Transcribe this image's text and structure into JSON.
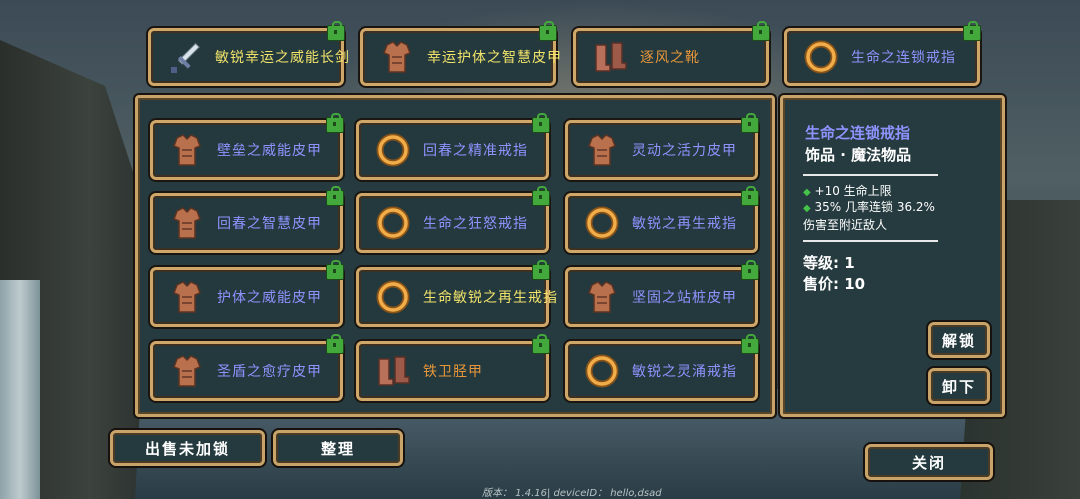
{
  "colors": {
    "name_blue": "#8e93ff",
    "name_yellow": "#f2e36a",
    "name_orange": "#e7963a",
    "lock_green": "#43a93c",
    "frame_gold": "#c9a46a",
    "panel_bg": "#263b3f"
  },
  "equipped": [
    {
      "icon": "sword-icon",
      "name": "敏锐幸运之威能长剑",
      "color": "name_yellow",
      "locked": true
    },
    {
      "icon": "armor-icon",
      "name": "幸运护体之智慧皮甲",
      "color": "name_yellow",
      "locked": true
    },
    {
      "icon": "boots-icon",
      "name": "逐风之靴",
      "color": "name_orange",
      "locked": true
    },
    {
      "icon": "ring-icon",
      "name": "生命之连锁戒指",
      "color": "name_blue",
      "locked": true
    }
  ],
  "inventory": [
    {
      "icon": "armor-icon",
      "name": "壁垒之威能皮甲",
      "color": "name_blue",
      "locked": true
    },
    {
      "icon": "ring-icon",
      "name": "回春之精准戒指",
      "color": "name_blue",
      "locked": true
    },
    {
      "icon": "armor-icon",
      "name": "灵动之活力皮甲",
      "color": "name_blue",
      "locked": true
    },
    {
      "icon": "armor-icon",
      "name": "回春之智慧皮甲",
      "color": "name_blue",
      "locked": true
    },
    {
      "icon": "ring-icon",
      "name": "生命之狂怒戒指",
      "color": "name_blue",
      "locked": true
    },
    {
      "icon": "ring-icon",
      "name": "敏锐之再生戒指",
      "color": "name_blue",
      "locked": true
    },
    {
      "icon": "armor-icon",
      "name": "护体之威能皮甲",
      "color": "name_blue",
      "locked": true
    },
    {
      "icon": "ring-icon",
      "name": "生命敏锐之再生戒指",
      "color": "name_yellow",
      "locked": true
    },
    {
      "icon": "armor-icon",
      "name": "坚固之站桩皮甲",
      "color": "name_blue",
      "locked": true
    },
    {
      "icon": "armor-icon",
      "name": "圣盾之愈疗皮甲",
      "color": "name_blue",
      "locked": true
    },
    {
      "icon": "boots-icon",
      "name": "铁卫胫甲",
      "color": "name_orange",
      "locked": true
    },
    {
      "icon": "ring-icon",
      "name": "敏锐之灵涌戒指",
      "color": "name_blue",
      "locked": true
    }
  ],
  "detail": {
    "title": "生命之连锁戒指",
    "subtitle": "饰品 · 魔法物品",
    "stats": [
      "+10 生命上限",
      "35% 几率连锁 36.2% 伤害至附近敌人"
    ],
    "level_label": "等级: 1",
    "price_label": "售价: 10",
    "unlock_label": "解锁",
    "unequip_label": "卸下"
  },
  "buttons": {
    "sell_unlocked": "出售未加锁",
    "organize": "整理",
    "close": "关闭"
  },
  "version_text": "版本： 1.4.16| deviceID： hello,dsad"
}
